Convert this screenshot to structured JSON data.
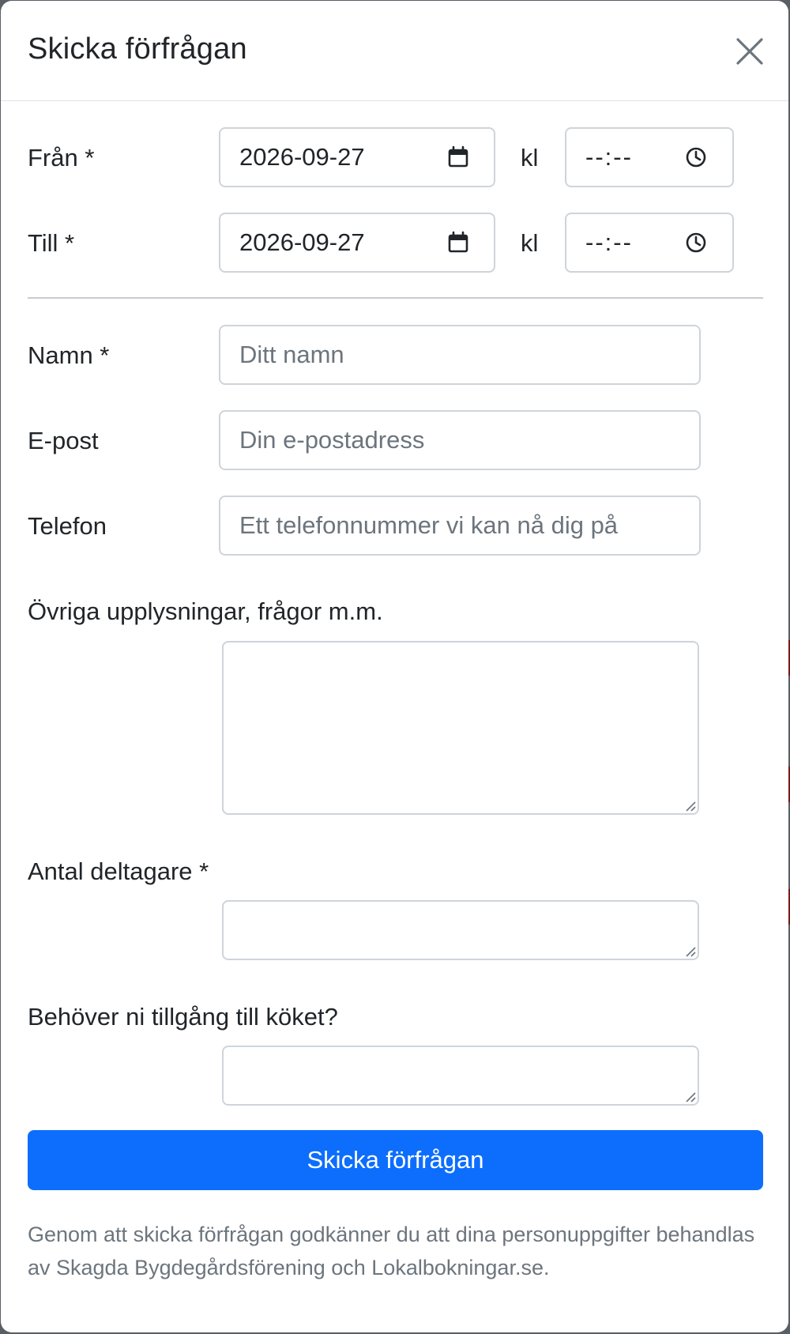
{
  "modal": {
    "title": "Skicka förfrågan",
    "close_icon": "close-icon"
  },
  "from": {
    "label": "Från *",
    "date_value": "2026-09-27",
    "date_icon": "calendar-icon",
    "time_prefix": "kl",
    "time_value": "--:--",
    "time_icon": "clock-icon"
  },
  "to": {
    "label": "Till *",
    "date_value": "2026-09-27",
    "date_icon": "calendar-icon",
    "time_prefix": "kl",
    "time_value": "--:--",
    "time_icon": "clock-icon"
  },
  "name": {
    "label": "Namn *",
    "placeholder": "Ditt namn"
  },
  "email": {
    "label": "E-post",
    "placeholder": "Din e-postadress"
  },
  "phone": {
    "label": "Telefon",
    "placeholder": "Ett telefonnummer vi kan nå dig på"
  },
  "notes": {
    "label": "Övriga upplysningar, frågor m.m.",
    "value": ""
  },
  "participants": {
    "label": "Antal deltagare *",
    "value": ""
  },
  "kitchen": {
    "label": "Behöver ni tillgång till köket?",
    "value": ""
  },
  "submit": {
    "label": "Skicka förfrågan"
  },
  "consent_text": "Genom att skicka förfrågan godkänner du att dina personuppgifter behandlas av Skagda Bygdegårdsförening och Lokalbokningar.se.",
  "colors": {
    "primary": "#0d6efd",
    "border": "#ced4da",
    "muted_text": "#6c757d",
    "text": "#212529"
  }
}
